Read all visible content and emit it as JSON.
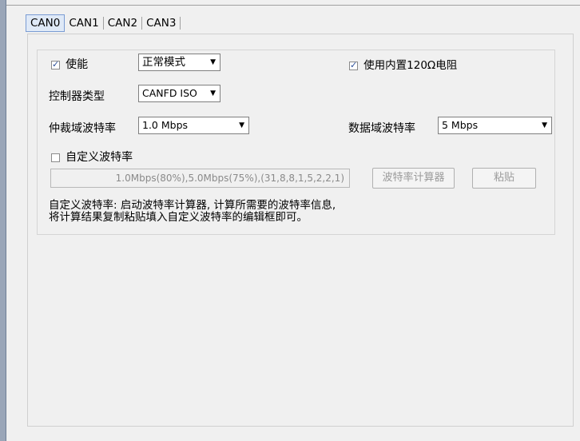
{
  "tabs": [
    "CAN0",
    "CAN1",
    "CAN2",
    "CAN3"
  ],
  "active_tab": 0,
  "enable": {
    "label": "使能",
    "checked": true
  },
  "mode_select": {
    "value": "正常模式"
  },
  "internal_resistor": {
    "label": "使用内置120Ω电阻",
    "checked": true
  },
  "controller_type": {
    "label": "控制器类型",
    "value": "CANFD ISO"
  },
  "arbitration_baud": {
    "label": "仲裁域波特率",
    "value": "1.0 Mbps"
  },
  "data_baud": {
    "label": "数据域波特率",
    "value": "5 Mbps"
  },
  "custom_baud": {
    "label": "自定义波特率",
    "checked": false,
    "value": "1.0Mbps(80%),5.0Mbps(75%),(31,8,8,1,5,2,2,1)"
  },
  "buttons": {
    "calculator": "波特率计算器",
    "paste": "粘贴"
  },
  "info": {
    "line1": "自定义波特率: 启动波特率计算器, 计算所需要的波特率信息,",
    "line2": "将计算结果复制粘贴填入自定义波特率的编辑框即可。"
  }
}
